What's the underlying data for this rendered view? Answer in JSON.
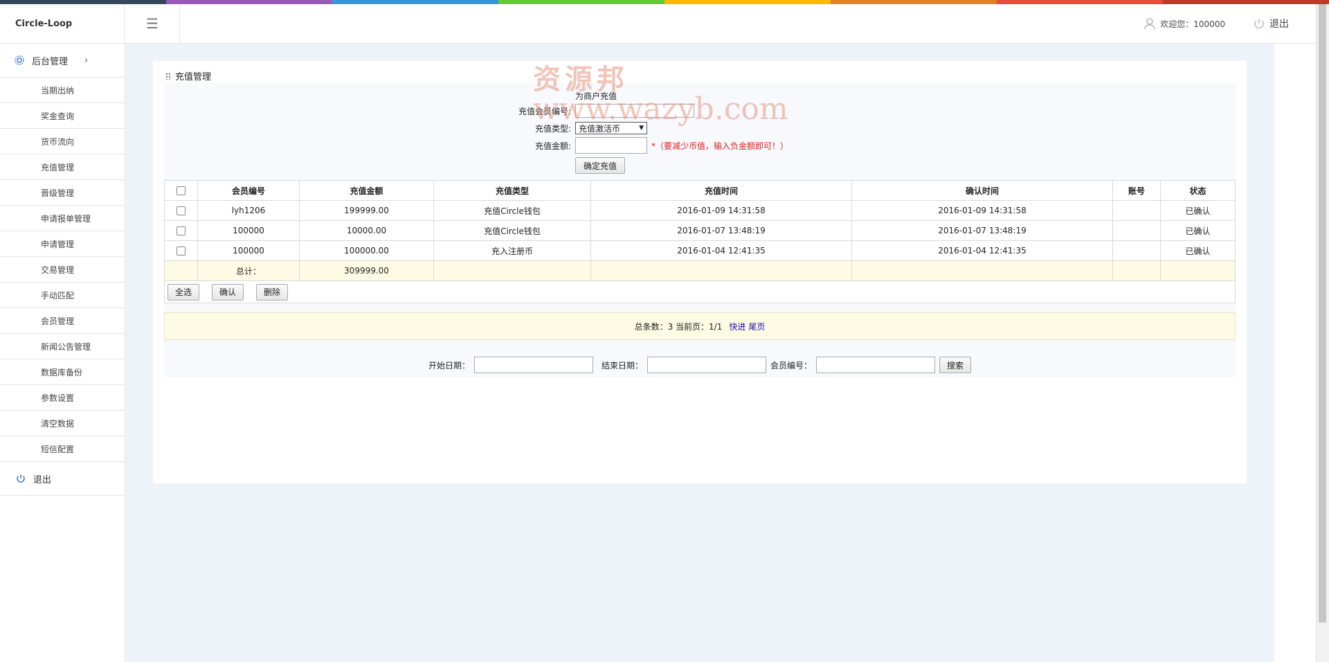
{
  "topbar_colors": [
    "#34495e",
    "#9b59b6",
    "#3498db",
    "#62cb31",
    "#ffb606",
    "#e67e22",
    "#e74c3c",
    "#c0392b"
  ],
  "header": {
    "brand": "Circle-Loop",
    "welcome": "欢迎您：100000",
    "logout": "退出"
  },
  "sidebar": {
    "group_label": "后台管理",
    "items": [
      "当期出纳",
      "奖金查询",
      "货币流向",
      "充值管理",
      "晋级管理",
      "申请报单管理",
      "申请管理",
      "交易管理",
      "手动匹配",
      "会员管理",
      "新闻公告管理",
      "数据库备份",
      "参数设置",
      "清空数据",
      "短信配置"
    ],
    "logout": "退出"
  },
  "panel": {
    "title": "充值管理",
    "form": {
      "section_title": "为商户充值",
      "member_label": "充值会员编号:",
      "type_label": "充值类型:",
      "type_value": "充值激活币",
      "amount_label": "充值金额:",
      "amount_hint": "*（要减少币值，输入负金额即可！）",
      "submit": "确定充值"
    },
    "table": {
      "headers": [
        "会员编号",
        "充值金额",
        "充值类型",
        "充值时间",
        "确认时间",
        "账号",
        "状态"
      ],
      "rows": [
        {
          "member": "lyh1206",
          "amount": "199999.00",
          "type": "充值Circle钱包",
          "time": "2016-01-09 14:31:58",
          "confirm": "2016-01-09 14:31:58",
          "account": "",
          "status": "已确认"
        },
        {
          "member": "100000",
          "amount": "10000.00",
          "type": "充值Circle钱包",
          "time": "2016-01-07 13:48:19",
          "confirm": "2016-01-07 13:48:19",
          "account": "",
          "status": "已确认"
        },
        {
          "member": "100000",
          "amount": "100000.00",
          "type": "充入注册币",
          "time": "2016-01-04 12:41:35",
          "confirm": "2016-01-04 12:41:35",
          "account": "",
          "status": "已确认"
        }
      ],
      "total_label": "总计：",
      "total_value": "309999.00"
    },
    "actions": {
      "select_all": "全选",
      "confirm": "确认",
      "delete": "删除"
    },
    "pager": {
      "summary": "总条数：3 当前页：1/1",
      "next": "快进",
      "last": "尾页"
    },
    "search": {
      "start_label": "开始日期：",
      "end_label": "结束日期：",
      "member_label": "会员编号：",
      "button": "搜索"
    }
  },
  "watermark": {
    "line1": "资源邦",
    "line2": "www.wazyb.com"
  }
}
